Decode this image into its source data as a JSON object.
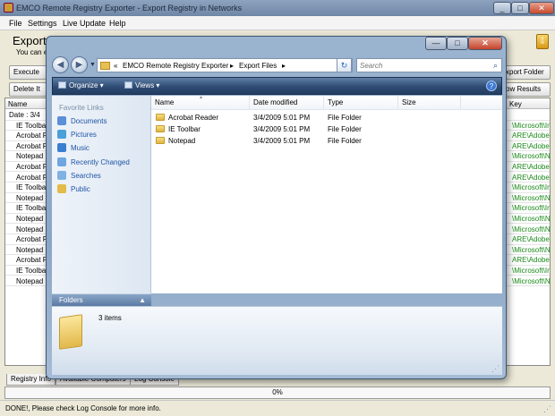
{
  "app": {
    "title": "EMCO Remote Registry Exporter - Export Registry in Networks",
    "caption_min": "_",
    "caption_max": "□",
    "caption_close": "✕",
    "menu": [
      "File",
      "Settings",
      "Live Update",
      "Help"
    ],
    "heading": "Export",
    "subheading": "You can e",
    "toolbar": {
      "execute_label": "Execute",
      "delete_label": "Delete It",
      "export_folder_label": "xport Folder",
      "show_results_label": "ow Results"
    },
    "table": {
      "col_name": "Name",
      "col_key": "Key",
      "date_row": "Date : 3/4",
      "rows": [
        {
          "name": "IE Toolbar",
          "key": "\\Microsoft\\Int"
        },
        {
          "name": "Acrobat Re",
          "key": "ARE\\Adobe\\A"
        },
        {
          "name": "Acrobat Re",
          "key": "ARE\\Adobe\\A"
        },
        {
          "name": "Notepad",
          "key": "\\Microsoft\\Nc"
        },
        {
          "name": "Acrobat Re",
          "key": "ARE\\Adobe\\A"
        },
        {
          "name": "Acrobat Re",
          "key": "ARE\\Adobe\\A"
        },
        {
          "name": "IE Toolbar",
          "key": "\\Microsoft\\Int"
        },
        {
          "name": "Notepad",
          "key": "\\Microsoft\\Nc"
        },
        {
          "name": "IE Toolbar",
          "key": "\\Microsoft\\Int"
        },
        {
          "name": "Notepad",
          "key": "\\Microsoft\\Nc"
        },
        {
          "name": "Notepad",
          "key": "\\Microsoft\\Nc"
        },
        {
          "name": "Acrobat Re",
          "key": "ARE\\Adobe\\A"
        },
        {
          "name": "Notepad",
          "key": "\\Microsoft\\Nc"
        },
        {
          "name": "Acrobat Re",
          "key": "ARE\\Adobe\\A"
        },
        {
          "name": "IE Toolbar",
          "key": "\\Microsoft\\Int"
        },
        {
          "name": "Notepad",
          "key": "\\Microsoft\\Nc"
        }
      ]
    },
    "tabs": [
      "Registry Info",
      "Available Computers",
      "Log Console"
    ],
    "progress_text": "0%",
    "progress": 0,
    "status": "DONE!, Please check Log Console for more info."
  },
  "explorer": {
    "caption_min": "—",
    "caption_max": "□",
    "caption_close": "✕",
    "back_glyph": "◀",
    "forward_glyph": "▶",
    "recent_glyph": "▼",
    "breadcrumb": [
      "«",
      "EMCO Remote Registry Exporter",
      "▸",
      "Export Files",
      "▸"
    ],
    "address_dropdown": "▼",
    "refresh_glyph": "↻",
    "search_placeholder": "Search",
    "search_glyph": "⌕",
    "organize_label": "Organize ▾",
    "views_label": "Views ▾",
    "help_glyph": "?",
    "favorite_links_header": "Favorite Links",
    "favorite_links": [
      {
        "label": "Documents",
        "icon": "documents-icon",
        "color": "#5b8fd6"
      },
      {
        "label": "Pictures",
        "icon": "pictures-icon",
        "color": "#4aa0d8"
      },
      {
        "label": "Music",
        "icon": "music-icon",
        "color": "#3b7fd0"
      },
      {
        "label": "Recently Changed",
        "icon": "recent-icon",
        "color": "#6fa6df"
      },
      {
        "label": "Searches",
        "icon": "searches-icon",
        "color": "#7fb2e2"
      },
      {
        "label": "Public",
        "icon": "public-icon",
        "color": "#e2bb48"
      }
    ],
    "folders_label": "Folders",
    "folders_chevron": "▲",
    "columns": {
      "name": "Name",
      "date": "Date modified",
      "type": "Type",
      "size": "Size"
    },
    "sort_glyph": "▲",
    "files": [
      {
        "name": "Acrobat Reader",
        "date": "3/4/2009 5:01 PM",
        "type": "File Folder",
        "size": ""
      },
      {
        "name": "IE Toolbar",
        "date": "3/4/2009 5:01 PM",
        "type": "File Folder",
        "size": ""
      },
      {
        "name": "Notepad",
        "date": "3/4/2009 5:01 PM",
        "type": "File Folder",
        "size": ""
      }
    ],
    "item_count": "3 items",
    "grip_glyph": "⋰"
  }
}
